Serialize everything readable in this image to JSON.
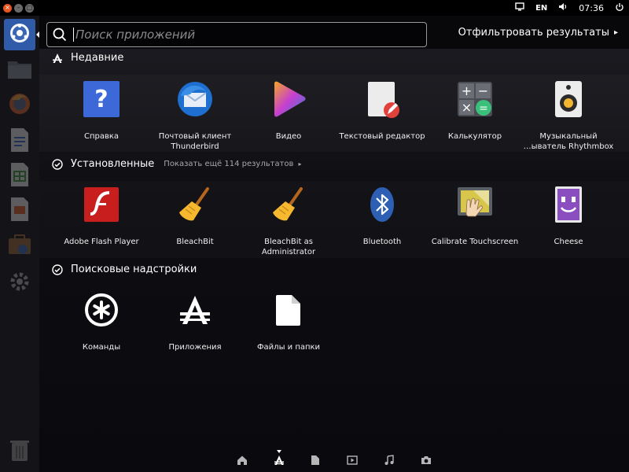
{
  "window_controls": {
    "close": "×",
    "minimize": "–",
    "maximize": "□"
  },
  "panel": {
    "keyboard_layout": "EN",
    "time": "07:36",
    "icons": [
      "screen-icon",
      "power-icon"
    ]
  },
  "search": {
    "placeholder": "Поиск приложений",
    "value": ""
  },
  "filter": {
    "label": "Отфильтровать результаты"
  },
  "sections": {
    "recent": {
      "title": "Недавние",
      "items": [
        {
          "label": "Справка",
          "icon": "help-icon"
        },
        {
          "label": "Почтовый клиент\nThunderbird",
          "icon": "thunderbird-icon"
        },
        {
          "label": "Видео",
          "icon": "video-icon"
        },
        {
          "label": "Текстовый редактор",
          "icon": "text-editor-icon"
        },
        {
          "label": "Калькулятор",
          "icon": "calculator-icon"
        },
        {
          "label": "Музыкальный\n…ыватель Rhythmbox",
          "icon": "rhythmbox-icon"
        }
      ]
    },
    "installed": {
      "title": "Установленные",
      "more": "Показать ещё 114 результатов",
      "items": [
        {
          "label": "Adobe Flash Player",
          "icon": "flash-icon"
        },
        {
          "label": "BleachBit",
          "icon": "broom-icon"
        },
        {
          "label": "BleachBit as\nAdministrator",
          "icon": "broom-admin-icon"
        },
        {
          "label": "Bluetooth",
          "icon": "bluetooth-icon"
        },
        {
          "label": "Calibrate Touchscreen",
          "icon": "touchscreen-icon"
        },
        {
          "label": "Cheese",
          "icon": "cheese-icon"
        }
      ]
    },
    "search_plugins": {
      "title": "Поисковые надстройки",
      "items": [
        {
          "label": "Команды",
          "icon": "commands-icon"
        },
        {
          "label": "Приложения",
          "icon": "applications-icon"
        },
        {
          "label": "Файлы и папки",
          "icon": "files-icon"
        }
      ]
    }
  },
  "lenses": [
    "home-lens-icon",
    "applications-lens-icon",
    "files-lens-icon",
    "video-lens-icon",
    "music-lens-icon",
    "photos-lens-icon"
  ],
  "launcher": [
    "dash-home-icon",
    "files-icon",
    "firefox-icon",
    "writer-icon",
    "calc-icon",
    "impress-icon",
    "software-center-icon",
    "settings-icon",
    "trash-icon"
  ]
}
